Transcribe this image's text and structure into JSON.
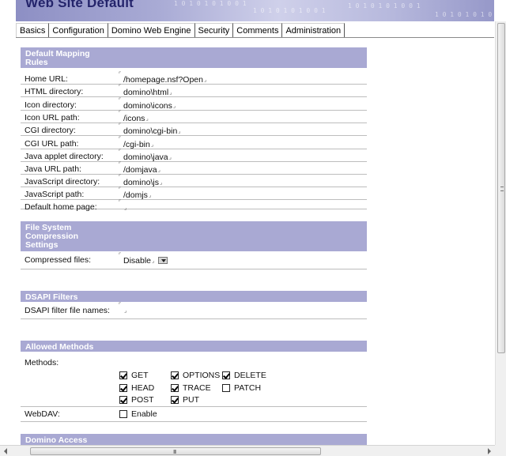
{
  "banner": {
    "title": "Web Site Default",
    "deco": "1 0 1 0 1 0 1 0 0 1"
  },
  "tabs": [
    "Basics",
    "Configuration",
    "Domino Web Engine",
    "Security",
    "Comments",
    "Administration"
  ],
  "sections": {
    "mapping": {
      "title": "Default Mapping Rules",
      "rows": [
        {
          "label": "Home URL:",
          "value": "/homepage.nsf?Open"
        },
        {
          "label": "HTML directory:",
          "value": "domino\\html"
        },
        {
          "label": "Icon directory:",
          "value": "domino\\icons"
        },
        {
          "label": "Icon URL path:",
          "value": "/icons"
        },
        {
          "label": "CGI directory:",
          "value": "domino\\cgi-bin"
        },
        {
          "label": "CGI URL path:",
          "value": "/cgi-bin"
        },
        {
          "label": "Java applet directory:",
          "value": "domino\\java"
        },
        {
          "label": "Java URL path:",
          "value": "/domjava"
        },
        {
          "label": "JavaScript directory:",
          "value": "domino\\js"
        },
        {
          "label": "JavaScript path:",
          "value": "/domjs"
        },
        {
          "label": "Default home page:",
          "value": ""
        }
      ]
    },
    "compression": {
      "title": "File System Compression Settings",
      "label": "Compressed files:",
      "value": "Disable"
    },
    "dsapi": {
      "title": "DSAPI Filters",
      "label": "DSAPI filter file names:",
      "value": ""
    },
    "methods": {
      "title": "Allowed Methods",
      "label": "Methods:",
      "items": [
        {
          "label": "GET",
          "checked": true
        },
        {
          "label": "OPTIONS",
          "checked": true
        },
        {
          "label": "DELETE",
          "checked": true
        },
        {
          "label": "HEAD",
          "checked": true
        },
        {
          "label": "TRACE",
          "checked": true
        },
        {
          "label": "PATCH",
          "checked": false
        },
        {
          "label": "POST",
          "checked": true
        },
        {
          "label": "PUT",
          "checked": true
        }
      ],
      "webdav_label": "WebDAV:",
      "webdav_option": "Enable",
      "webdav_checked": false
    },
    "access": {
      "title": "Domino Access"
    }
  },
  "field_marker_open": "⌜",
  "field_marker_close": "⌟",
  "scrollbar_grip": "III"
}
